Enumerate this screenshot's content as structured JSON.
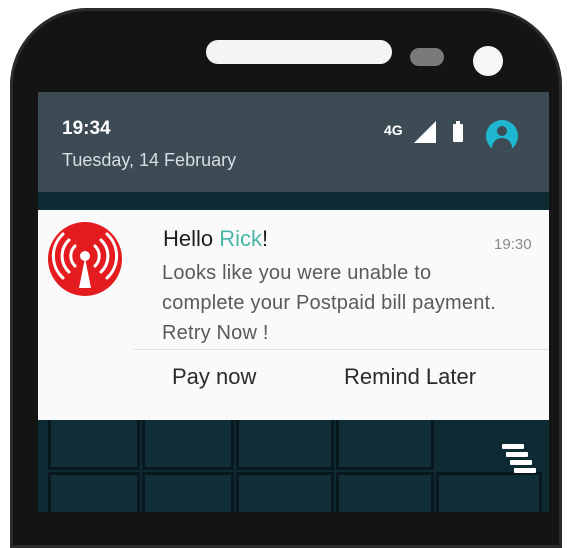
{
  "statusbar": {
    "time": "19:34",
    "date": "Tuesday, 14 February",
    "network": "4G",
    "icons": [
      "signal-icon",
      "battery-icon",
      "account-icon"
    ],
    "accent_color": "#1fb6cf"
  },
  "notification": {
    "app_icon": "broadcast-antenna-icon",
    "brand_color": "#e41c1f",
    "title_prefix": "Hello ",
    "title_name": "Rick",
    "title_suffix": "!",
    "name_color": "#4ab6a9",
    "time": "19:30",
    "message": "Looks like you were unable to complete your Postpaid bill payment. Retry Now !",
    "actions": [
      {
        "label": "Pay now"
      },
      {
        "label": "Remind Later"
      }
    ]
  },
  "wallpaper": {
    "menu_icon": "stacked-bars-icon"
  }
}
